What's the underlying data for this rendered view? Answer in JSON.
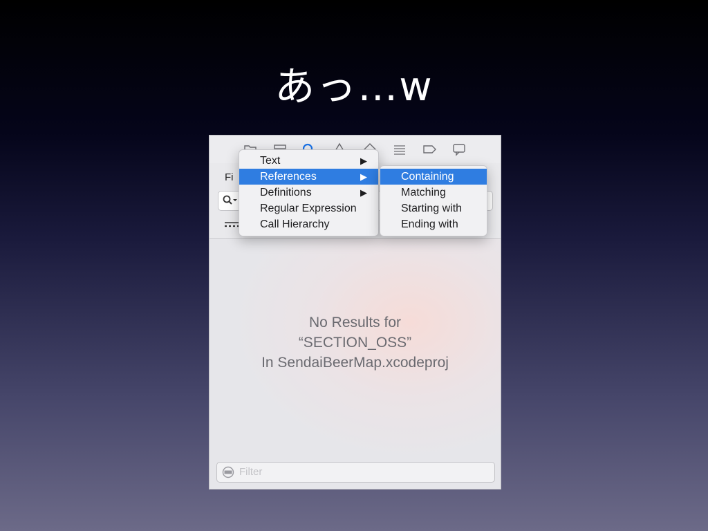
{
  "slide": {
    "title": "あっ…w"
  },
  "find_navigator": {
    "tabs": [
      "folder-icon",
      "hierarchy-icon",
      "search-icon",
      "warning-icon",
      "test-icon",
      "debug-icon",
      "breakpoint-icon",
      "report-icon"
    ],
    "find_label_partial": "Fi",
    "result": {
      "line1": "No Results for",
      "line2": "“SECTION_OSS”",
      "line3": "In SendaiBeerMap.xcodeproj"
    },
    "filter_placeholder": "Filter"
  },
  "find_mode_menu": {
    "items": [
      {
        "label": "Text",
        "arrow": "▶"
      },
      {
        "label": "References",
        "arrow": "▶"
      },
      {
        "label": "Definitions",
        "arrow": "▶"
      },
      {
        "label": "Regular Expression"
      },
      {
        "label": "Call Hierarchy"
      }
    ],
    "selected": "References"
  },
  "submenu": {
    "items": [
      {
        "label": "Containing"
      },
      {
        "label": "Matching"
      },
      {
        "label": "Starting with"
      },
      {
        "label": "Ending with"
      }
    ],
    "selected": "Containing"
  },
  "colors": {
    "selection": "#2f7de1",
    "accent": "#1a73e8"
  }
}
